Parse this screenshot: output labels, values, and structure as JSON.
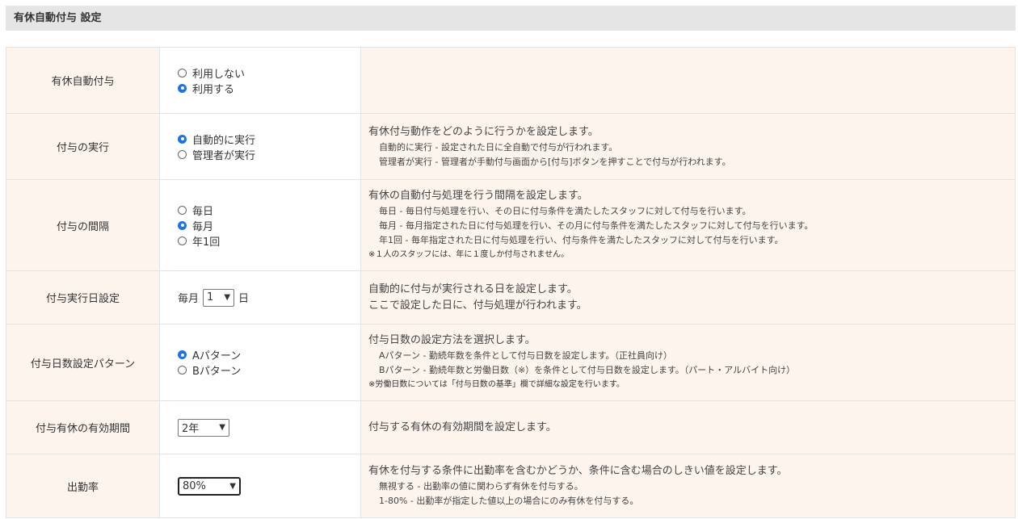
{
  "header": {
    "title": "有休自動付与 設定"
  },
  "rows": {
    "auto_grant": {
      "label": "有休自動付与",
      "options": [
        "利用しない",
        "利用する"
      ],
      "selected": 1
    },
    "execution": {
      "label": "付与の実行",
      "options": [
        "自動的に実行",
        "管理者が実行"
      ],
      "selected": 0,
      "desc_title": "有休付与動作をどのように行うかを設定します。",
      "desc_lines": [
        "自動的に実行 - 設定された日に全自動で付与が行われます。",
        "管理者が実行 - 管理者が手動付与画面から[付与]ボタンを押すことで付与が行われます。"
      ]
    },
    "interval": {
      "label": "付与の間隔",
      "options": [
        "毎日",
        "毎月",
        "年1回"
      ],
      "selected": 1,
      "desc_title": "有休の自動付与処理を行う間隔を設定します。",
      "desc_lines": [
        "毎日 - 毎日付与処理を行い、その日に付与条件を満たしたスタッフに対して付与を行います。",
        "毎月 - 毎月指定された日に付与処理を行い、その月に付与条件を満たしたスタッフに対して付与を行います。",
        "年1回 - 毎年指定された日に付与処理を行い、付与条件を満たしたスタッフに対して付与を行います。"
      ],
      "desc_note": "※１人のスタッフには、年に１度しか付与されません。"
    },
    "exec_day": {
      "label": "付与実行日設定",
      "prefix": "毎月",
      "value": "1",
      "suffix": "日",
      "desc_title_1": "自動的に付与が実行される日を設定します。",
      "desc_title_2": "ここで設定した日に、付与処理が行われます。"
    },
    "pattern": {
      "label": "付与日数設定パターン",
      "options": [
        "Aパターン",
        "Bパターン"
      ],
      "selected": 0,
      "desc_title": "付与日数の設定方法を選択します。",
      "desc_lines": [
        "Aパターン - 勤続年数を条件として付与日数を設定します。（正社員向け）",
        "Bパターン - 勤続年数と労働日数（※）を条件として付与日数を設定します。（パート・アルバイト向け）"
      ],
      "desc_note": "※労働日数については「付与日数の基準」欄で詳細な設定を行います。"
    },
    "validity": {
      "label": "付与有休の有効期間",
      "value": "2年",
      "desc_title": "付与する有休の有効期間を設定します。"
    },
    "attendance": {
      "label": "出勤率",
      "value": "80%",
      "desc_title": "有休を付与する条件に出勤率を含むかどうか、条件に含む場合のしきい値を設定します。",
      "desc_lines": [
        "無視する - 出勤率の値に関わらず有休を付与する。",
        "1-80% - 出勤率が指定した値以上の場合にのみ有休を付与する。"
      ]
    }
  }
}
